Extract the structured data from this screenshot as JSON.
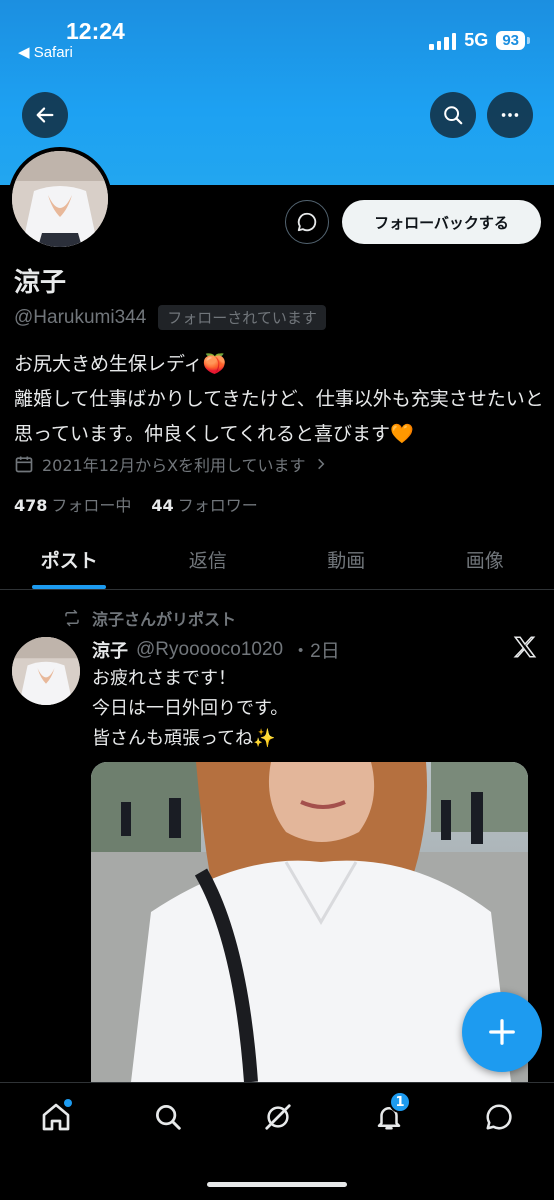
{
  "status_bar": {
    "time": "12:24",
    "back_app": "◀ Safari",
    "network": "5G",
    "battery": "93"
  },
  "profile": {
    "display_name": "涼子",
    "handle": "@Harukumi344",
    "follows_you": "フォローされています",
    "followback_label": "フォローバックする",
    "bio_line1": "お尻大きめ生保レディ🍑",
    "bio_line2": "離婚して仕事ばかりしてきたけど、仕事以外も充実させたいと思っています。仲良くしてくれると喜びます🧡",
    "joined": "2021年12月からXを利用しています",
    "following_count": "478",
    "following_label": "フォロー中",
    "followers_count": "44",
    "followers_label": "フォロワー"
  },
  "tabs": [
    {
      "label": "ポスト",
      "active": true
    },
    {
      "label": "返信",
      "active": false
    },
    {
      "label": "動画",
      "active": false
    },
    {
      "label": "画像",
      "active": false
    }
  ],
  "post": {
    "repost_label": "涼子さんがリポスト",
    "author_name": "涼子",
    "author_handle": "@Ryooooco1020",
    "time_ago": "・2日",
    "text_line1": "お疲れさまです！",
    "text_line2": "今日は一日外回りです。",
    "text_line3": "皆さんも頑張ってね✨"
  },
  "bottom_nav": {
    "notification_count": "1",
    "icons": [
      "home-icon",
      "search-icon",
      "grok-icon",
      "bell-icon",
      "messages-icon"
    ]
  },
  "colors": {
    "accent": "#1d9bf0",
    "banner": "#1da1f2",
    "background": "#000000"
  }
}
